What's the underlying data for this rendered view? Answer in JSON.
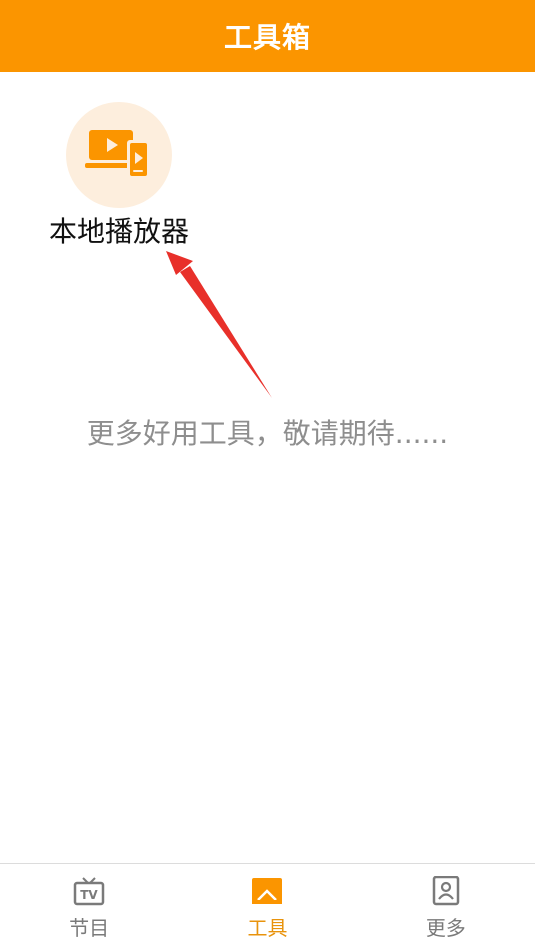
{
  "header": {
    "title": "工具箱"
  },
  "tools": [
    {
      "label": "本地播放器",
      "icon": "local-player-icon"
    }
  ],
  "main": {
    "coming_soon": "更多好用工具，敬请期待......"
  },
  "tabbar": {
    "items": [
      {
        "label": "节目",
        "icon": "tv-icon",
        "active": false
      },
      {
        "label": "工具",
        "icon": "toolbox-icon",
        "active": true
      },
      {
        "label": "更多",
        "icon": "profile-icon",
        "active": false
      }
    ]
  },
  "colors": {
    "accent": "#fb9500",
    "icon_bg": "#fdeedd",
    "annotation_arrow": "#e8302a",
    "tab_active": "#e8930c",
    "tab_inactive": "#7a7a7a"
  }
}
